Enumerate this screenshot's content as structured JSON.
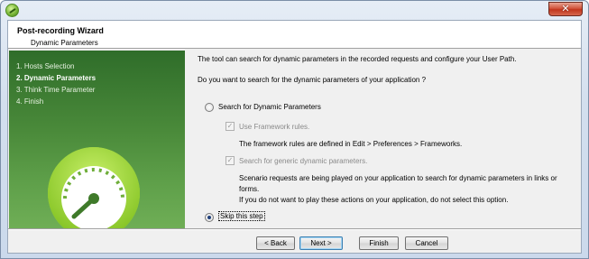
{
  "window": {
    "close_label": "✕"
  },
  "header": {
    "title": "Post-recording Wizard",
    "subtitle": "Dynamic Parameters"
  },
  "sidebar": {
    "steps": [
      {
        "label": "1. Hosts Selection",
        "active": false
      },
      {
        "label": "2. Dynamic Parameters",
        "active": true
      },
      {
        "label": "3. Think Time Parameter",
        "active": false
      },
      {
        "label": "4. Finish",
        "active": false
      }
    ],
    "logo_icon": "speedometer-gauge-icon"
  },
  "content": {
    "intro": "The tool can search for dynamic parameters in the recorded requests and configure your User Path.",
    "question": "Do you want to search for the dynamic parameters of your application ?",
    "option_search": {
      "label": "Search for Dynamic Parameters",
      "selected": false
    },
    "framework_rules": {
      "label": "Use Framework rules.",
      "checked": true,
      "enabled": false,
      "description": "The framework rules are defined in Edit > Preferences > Frameworks."
    },
    "generic_params": {
      "label": "Search for generic dynamic parameters.",
      "checked": true,
      "enabled": false,
      "description_lines": [
        "Scenario requests are being played on your application to search for dynamic parameters in links or",
        "forms.",
        "If you do not want to play these actions on your application, do not select this option."
      ]
    },
    "option_skip": {
      "label": "Skip this step",
      "selected": true
    }
  },
  "buttons": {
    "back": "< Back",
    "next": "Next >",
    "finish": "Finish",
    "cancel": "Cancel"
  },
  "colors": {
    "sidebar_top": "#2f6d2a",
    "sidebar_bottom": "#6fae56",
    "gauge_green": "#8fcf2a",
    "close_red": "#c1361d"
  }
}
